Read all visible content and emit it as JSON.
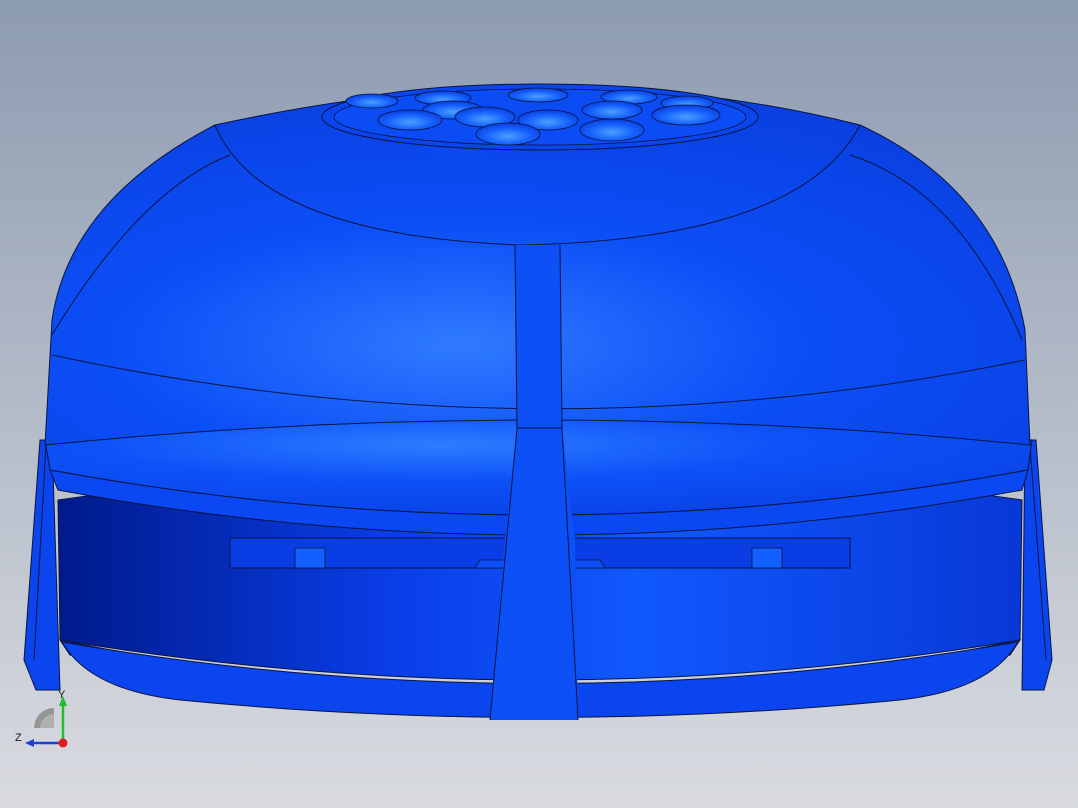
{
  "viewport": {
    "background_top": "#8d9bb0",
    "background_bottom": "#d9dbe0",
    "part_color": "#0b47f5",
    "part_highlight": "#2f7bff",
    "part_shadow": "#0033c8",
    "edge_color": "#0a1540"
  },
  "triad": {
    "y_label": "Y",
    "z_label": "Z",
    "y_color": "#1fbf2a",
    "z_color": "#1d3fd8",
    "x_color": "#e01b1b"
  }
}
